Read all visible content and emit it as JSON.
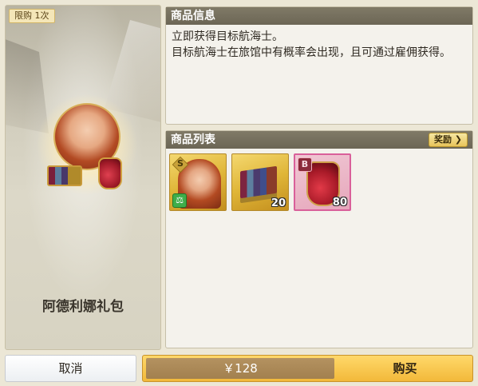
{
  "banner": {
    "limit_badge": "限购 1次",
    "gift_name": "阿德利娜礼包"
  },
  "info_panel": {
    "title": "商品信息",
    "line1": "立即获得目标航海士。",
    "line2": "目标航海士在旅馆中有概率会出现，且可通过雇佣获得。"
  },
  "list_panel": {
    "title": "商品列表",
    "reward_button": "奖励 ❯",
    "items": [
      {
        "icon": "navigator-portrait-icon",
        "rank": "S",
        "class_icon": "scales-icon",
        "class_glyph": "⚖"
      },
      {
        "icon": "book-set-icon",
        "quantity": "20"
      },
      {
        "icon": "potion-bottle-icon",
        "rank": "B",
        "quantity": "80"
      }
    ]
  },
  "footer": {
    "cancel_label": "取消",
    "price": "￥128",
    "buy_label": "购买"
  },
  "colors": {
    "header_bg": "#807a67",
    "buy_gold": "#f2b93a",
    "price_bg": "#a2804f",
    "rose_border": "#d9609a"
  }
}
